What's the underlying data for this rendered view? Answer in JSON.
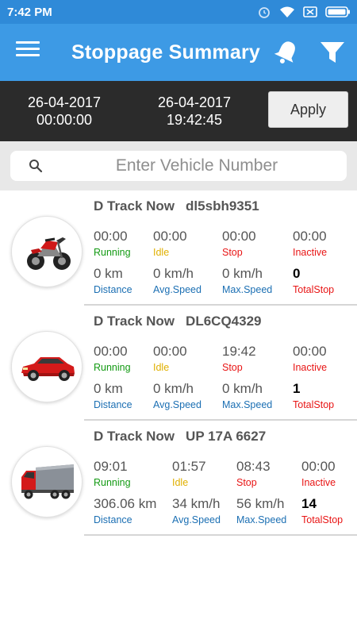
{
  "status_bar": {
    "time": "7:42 PM"
  },
  "app_bar": {
    "title": "Stoppage Summary"
  },
  "date_range": {
    "from_date": "26-04-2017",
    "from_time": "00:00:00",
    "to_date": "26-04-2017",
    "to_time": "19:42:45",
    "apply_label": "Apply"
  },
  "search": {
    "placeholder": "Enter Vehicle Number"
  },
  "labels": {
    "running": "Running",
    "idle": "Idle",
    "stop": "Stop",
    "inactive": "Inactive",
    "distance": "Distance",
    "avg_speed": "Avg.Speed",
    "max_speed": "Max.Speed",
    "total_stop": "TotalStop"
  },
  "colors": {
    "running": "#139a13",
    "idle": "#e0b000",
    "stop": "#e81515",
    "inactive": "#e81515",
    "metric": "#1b6fb3",
    "app_bar": "#3d9ae5"
  },
  "vehicles": [
    {
      "company": "D Track Now",
      "number": "dl5sbh9351",
      "icon": "motorcycle-icon",
      "running": "00:00",
      "idle": "00:00",
      "stop": "00:00",
      "inactive": "00:00",
      "distance": "0 km",
      "avg_speed": "0 km/h",
      "max_speed": "0 km/h",
      "total_stop": "0"
    },
    {
      "company": "D Track Now",
      "number": "DL6CQ4329",
      "icon": "car-icon",
      "running": "00:00",
      "idle": "00:00",
      "stop": "19:42",
      "inactive": "00:00",
      "distance": "0 km",
      "avg_speed": "0 km/h",
      "max_speed": "0 km/h",
      "total_stop": "1"
    },
    {
      "company": "D Track Now",
      "number": "UP 17A 6627",
      "icon": "truck-icon",
      "running": "09:01",
      "idle": "01:57",
      "stop": "08:43",
      "inactive": "00:00",
      "distance": "306.06 km",
      "avg_speed": "34 km/h",
      "max_speed": "56 km/h",
      "total_stop": "14"
    }
  ]
}
